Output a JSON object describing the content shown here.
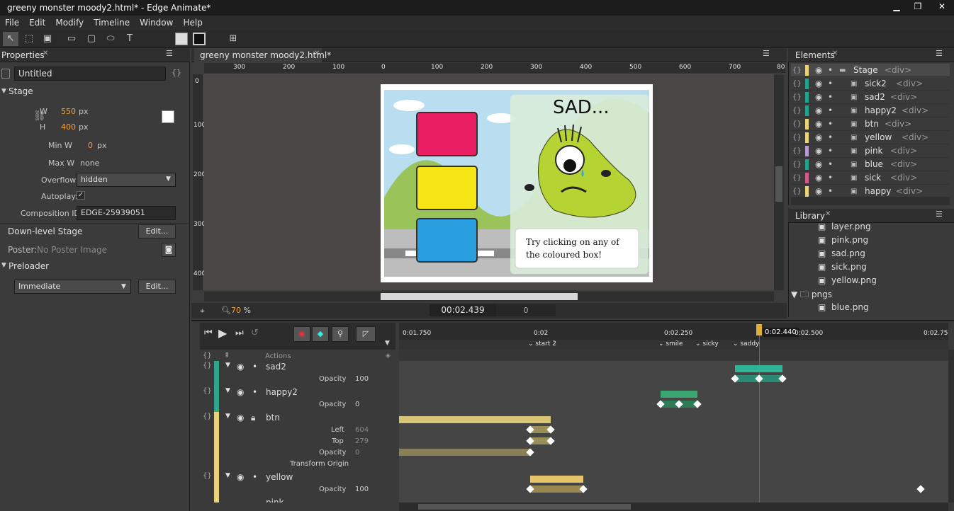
{
  "window": {
    "title": "greeny monster moody2.html* - Edge Animate*",
    "min": "▁",
    "max": "❐",
    "close": "✕"
  },
  "menu": [
    "File",
    "Edit",
    "Modify",
    "Timeline",
    "Window",
    "Help"
  ],
  "properties": {
    "tab": "Properties",
    "composition_name": "Untitled",
    "stage_label": "Stage",
    "w_label": "W",
    "w_value": "550",
    "w_unit": "px",
    "h_label": "H",
    "h_value": "400",
    "h_unit": "px",
    "minw_label": "Min W",
    "minw_value": "0",
    "minw_unit": "px",
    "maxw_label": "Max W",
    "maxw_value": "none",
    "overflow_label": "Overflow:",
    "overflow_value": "hidden",
    "autoplay_label": "Autoplay:",
    "autoplay_check": "✓",
    "compid_label": "Composition ID:",
    "compid_value": "EDGE-25939051",
    "downlevel_label": "Down-level Stage",
    "edit1": "Edit...",
    "poster_label": "Poster:",
    "poster_value": "No Poster Image",
    "preloader_label": "Preloader",
    "preloader_value": "Immediate",
    "edit2": "Edit..."
  },
  "document": {
    "tab": "greeny monster moody2.html*",
    "ruler_labels": [
      "300",
      "200",
      "100",
      "0",
      "100",
      "200",
      "300",
      "400",
      "500",
      "600",
      "700",
      "80"
    ],
    "vruler_labels": [
      "0",
      "100",
      "200",
      "300",
      "400"
    ],
    "zoom": "70",
    "zoom_unit": "%",
    "time": "00:02.439",
    "offset": "0"
  },
  "stage": {
    "sad_text": "SAD...",
    "hint_line1": "Try clicking on any of",
    "hint_line2": "the coloured box!",
    "box_colors": [
      "#e91e63",
      "#f5e514",
      "#2a9fe0"
    ]
  },
  "elements": {
    "tab": "Elements",
    "items": [
      {
        "name": "Stage",
        "tag": "<div>",
        "color": "#e8d27a"
      },
      {
        "name": "sick2",
        "tag": "<div>",
        "color": "#22a38e"
      },
      {
        "name": "sad2",
        "tag": "<div>",
        "color": "#22a38e"
      },
      {
        "name": "happy2",
        "tag": "<div>",
        "color": "#22a38e"
      },
      {
        "name": "btn",
        "tag": "<div>",
        "color": "#e8d27a"
      },
      {
        "name": "yellow",
        "tag": "<div>",
        "color": "#e8d27a"
      },
      {
        "name": "pink",
        "tag": "<div>",
        "color": "#b89ad6"
      },
      {
        "name": "blue",
        "tag": "<div>",
        "color": "#22a38e"
      },
      {
        "name": "sick",
        "tag": "<div>",
        "color": "#d05a8a"
      },
      {
        "name": "happy",
        "tag": "<div>",
        "color": "#e8d27a"
      }
    ]
  },
  "library": {
    "tab": "Library",
    "items": [
      "layer.png",
      "pink.png",
      "sad.png",
      "sick.png",
      "yellow.png"
    ],
    "folder": "pngs",
    "folder_items": [
      "blue.png"
    ]
  },
  "timeline": {
    "times": [
      "0:01.750",
      "0:02",
      "0:02.250",
      "0:02.440",
      "0:02.500",
      "0:02.75"
    ],
    "labels": [
      "start 2",
      "smile",
      "sicky",
      "saddy"
    ],
    "actions": "Actions",
    "rows": {
      "sad2": "sad2",
      "sad2_prop": "Opacity",
      "sad2_val": "100",
      "happy2": "happy2",
      "happy2_prop": "Opacity",
      "happy2_val": "0",
      "btn": "btn",
      "btn_left": "Left",
      "btn_left_val": "604",
      "btn_top": "Top",
      "btn_top_val": "279",
      "btn_opacity": "Opacity",
      "btn_opacity_val": "0",
      "btn_origin": "Transform Origin",
      "yellow": "yellow",
      "yellow_prop": "Opacity",
      "yellow_val": "100",
      "pink": "pink"
    }
  }
}
